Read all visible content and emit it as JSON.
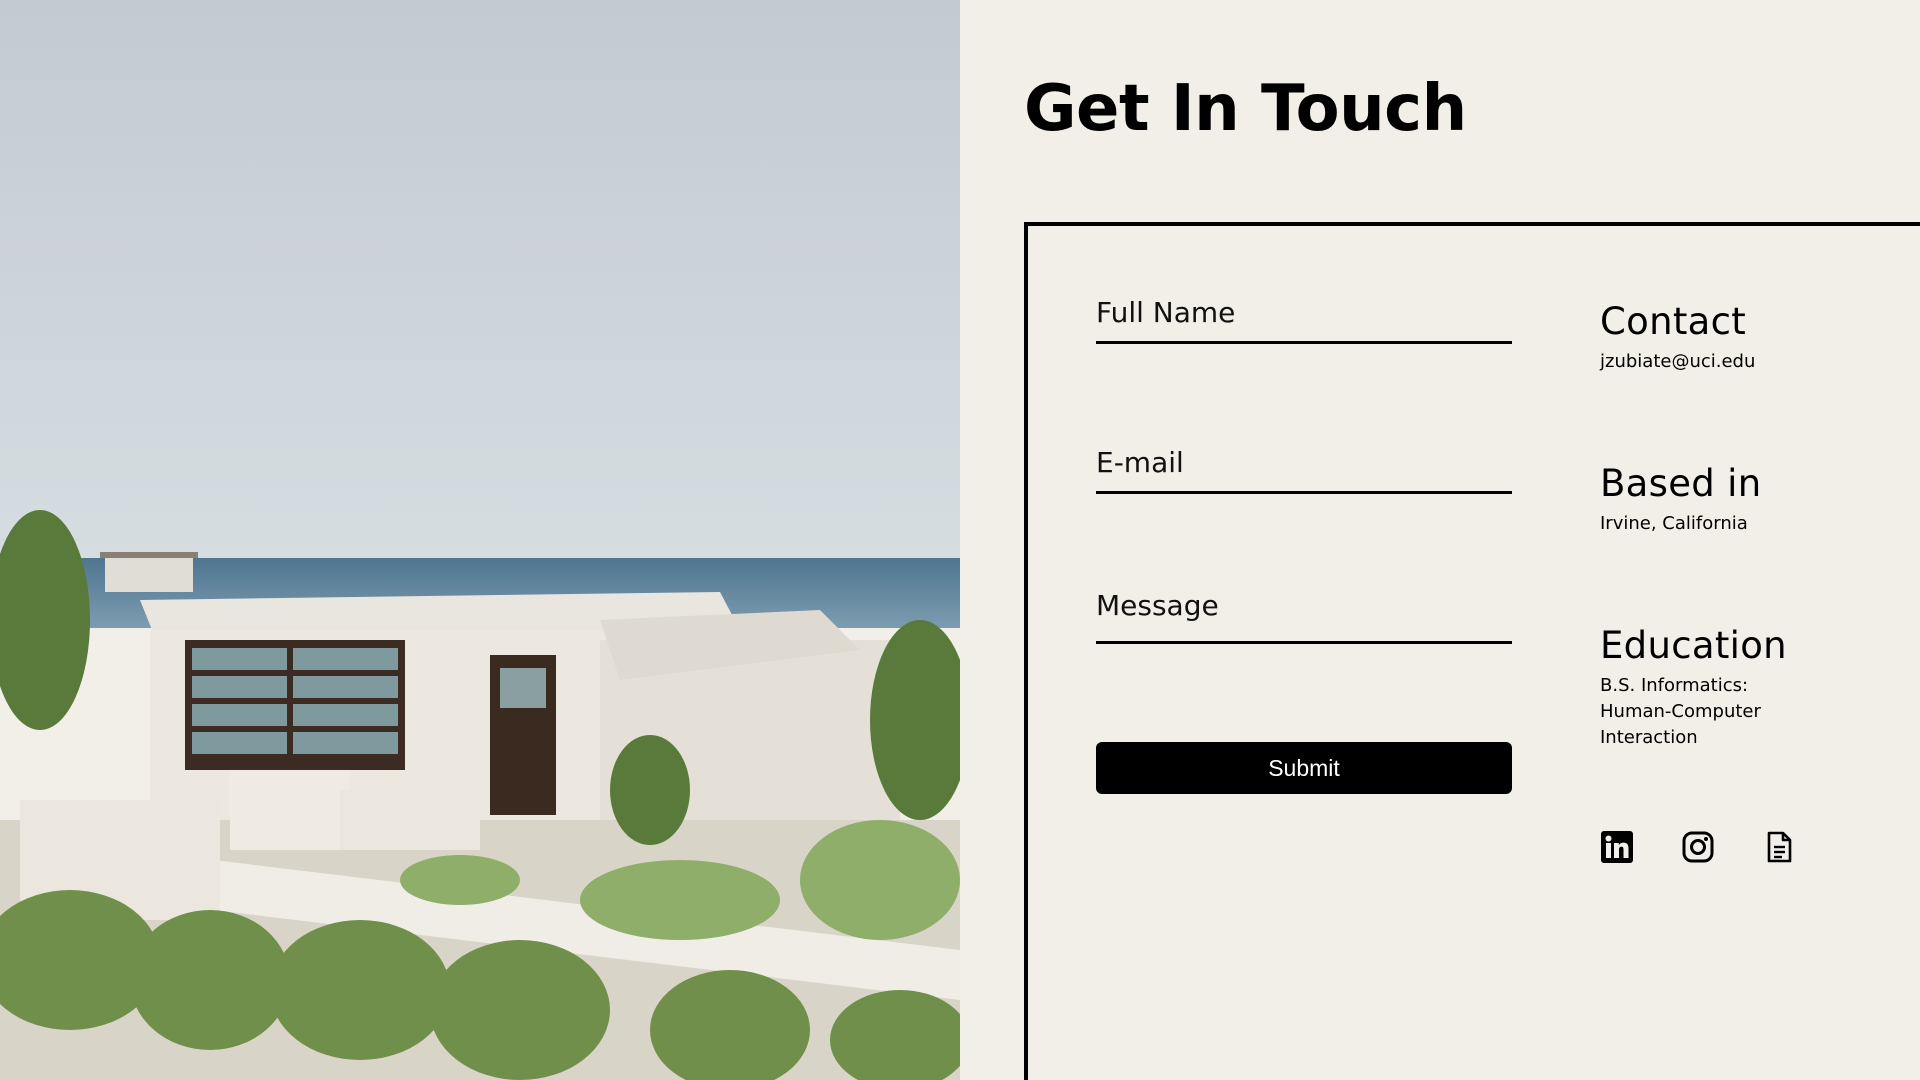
{
  "page": {
    "title": "Get In Touch"
  },
  "photo": {
    "description_icon": "beach-house-photo",
    "sky_color": "#c5ccd2",
    "sea_color": "#5e8199"
  },
  "form": {
    "full_name_placeholder": "Full Name",
    "email_placeholder": "E-mail",
    "message_placeholder": "Message",
    "submit_label": "Submit"
  },
  "info": {
    "contact": {
      "heading": "Contact",
      "value": "jzubiate@uci.edu"
    },
    "based": {
      "heading": "Based in",
      "value": "Irvine, California"
    },
    "education": {
      "heading": "Education",
      "lines": [
        "B.S. Informatics:",
        "Human-Computer",
        "Interaction"
      ]
    }
  },
  "socials": [
    {
      "icon": "linkedin-icon"
    },
    {
      "icon": "instagram-icon"
    },
    {
      "icon": "document-icon"
    }
  ],
  "colors": {
    "background": "#f2efe9",
    "text": "#000000",
    "button": "#000000",
    "button_text": "#ffffff"
  }
}
